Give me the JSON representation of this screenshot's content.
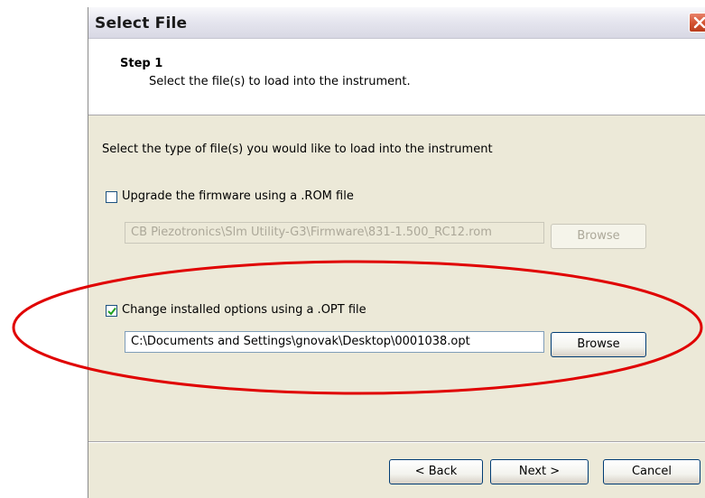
{
  "window": {
    "title": "Select File"
  },
  "header": {
    "step_title": "Step 1",
    "step_description": "Select the file(s) to load into the instrument."
  },
  "body": {
    "instruction": "Select the type of file(s) you would like to load into the instrument",
    "firmware_option": {
      "label": "Upgrade the firmware using a .ROM file",
      "checked": false,
      "path_value": "CB Piezotronics\\Slm Utility-G3\\Firmware\\831-1.500_RC12.rom",
      "browse_label": "Browse",
      "enabled": false
    },
    "options_option": {
      "label": "Change installed options using a .OPT file",
      "checked": true,
      "path_value": "C:\\Documents and Settings\\gnovak\\Desktop\\0001038.opt",
      "browse_label": "Browse",
      "enabled": true
    }
  },
  "footer": {
    "back_label": "< Back",
    "next_label": "Next >",
    "cancel_label": "Cancel"
  },
  "colors": {
    "annotation_ellipse": "#e00000",
    "checkbox_check": "#21a121",
    "close_button": "#d2512f"
  },
  "icons": {
    "close": "close-icon",
    "check": "checkmark-icon"
  }
}
